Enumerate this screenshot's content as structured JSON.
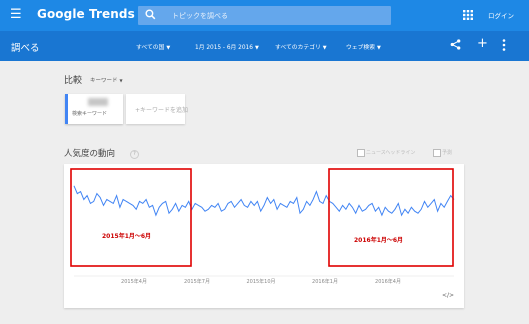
{
  "header": {
    "brand": "Google Trends",
    "search_placeholder": "トピックを調べる",
    "login_label": "ログイン"
  },
  "subheader": {
    "title": "調べる",
    "filters": [
      {
        "label": "すべての国"
      },
      {
        "label": "1月 2015 - 6月 2016"
      },
      {
        "label": "すべてのカテゴリ"
      },
      {
        "label": "ウェブ検索"
      }
    ]
  },
  "compare": {
    "title": "比較",
    "type_label": "キーワード",
    "term_subtitle": "検索キーワード",
    "add_placeholder": "+キーワードを追加"
  },
  "interest": {
    "title": "人気度の動向",
    "option_1": "ニュースヘッドライン",
    "option_2": "予測"
  },
  "chart_data": {
    "type": "line",
    "x_tick_labels": [
      "2015年4月",
      "2015年7月",
      "2015年10月",
      "2016年1月",
      "2016年4月"
    ],
    "values": [
      88,
      80,
      82,
      74,
      78,
      70,
      72,
      80,
      76,
      68,
      74,
      72,
      70,
      78,
      66,
      74,
      72,
      70,
      68,
      64,
      72,
      70,
      74,
      66,
      68,
      58,
      66,
      70,
      72,
      60,
      64,
      70,
      62,
      68,
      66,
      72,
      64,
      70,
      68,
      66,
      62,
      64,
      68,
      66,
      70,
      62,
      64,
      70,
      72,
      66,
      70,
      74,
      68,
      66,
      72,
      68,
      72,
      62,
      68,
      76,
      70,
      74,
      64,
      70,
      68,
      66,
      72,
      70,
      76,
      60,
      64,
      72,
      68,
      74,
      82,
      72,
      70,
      78,
      72,
      70,
      66,
      62,
      68,
      64,
      70,
      66,
      60,
      68,
      62,
      64,
      68,
      70,
      62,
      66,
      58,
      66,
      62,
      60,
      64,
      70,
      58,
      64,
      60,
      66,
      62,
      60,
      64,
      72,
      66,
      70,
      74,
      62,
      70,
      66,
      72,
      78,
      74
    ],
    "ylim": [
      0,
      100
    ],
    "color": "#4285f4",
    "annotations": [
      {
        "label": "2015年1月〜6月"
      },
      {
        "label": "2016年1月〜6月"
      }
    ],
    "annotation_color": "#e00000",
    "annotation_text_color": "#cc0000"
  }
}
